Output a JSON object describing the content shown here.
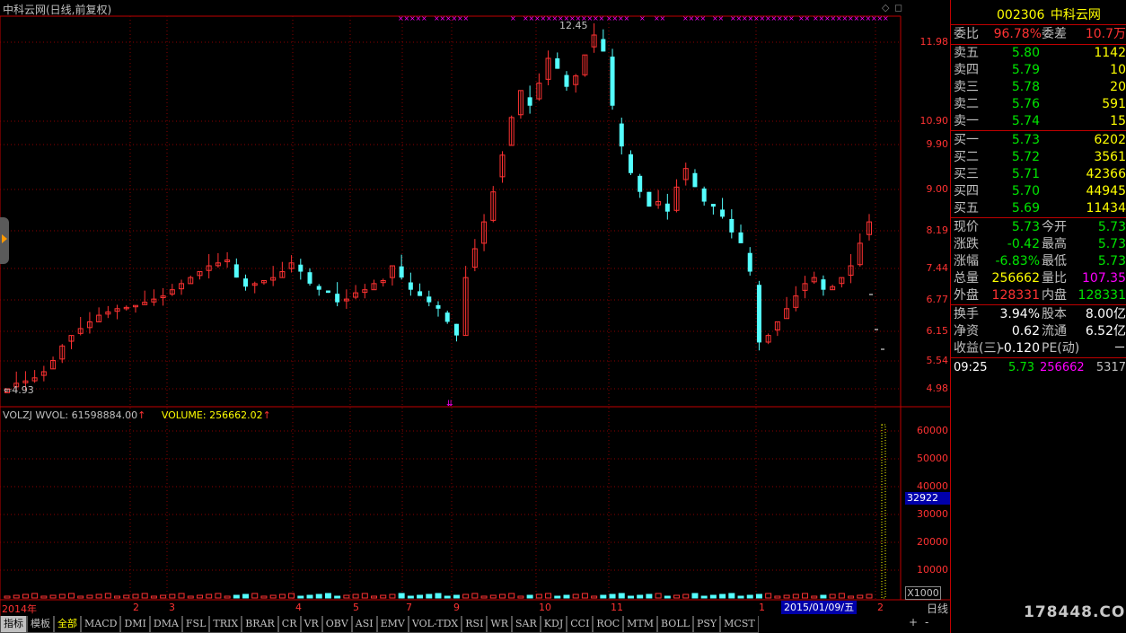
{
  "chart_header": {
    "title": "中科云网(日线,前复权)",
    "high_label": "12.45",
    "low_label": "4.93"
  },
  "price_axis": [
    "11.98",
    "10.90",
    "9.90",
    "9.00",
    "8.19",
    "7.44",
    "6.77",
    "6.15",
    "5.54",
    "4.98"
  ],
  "volume_header": {
    "volzj": "VOLZJ",
    "wvol": "WVOL: 61598884.00",
    "volume": "VOLUME: 256662.02"
  },
  "volume_axis": [
    "60000",
    "50000",
    "40000",
    "30000",
    "20000",
    "10000"
  ],
  "volume_axis_highlight": "32922",
  "volume_unit": "X1000",
  "time_axis": [
    "2014年",
    "2",
    "3",
    "4",
    "5",
    "7",
    "9",
    "10",
    "11",
    "1",
    "2"
  ],
  "cursor_date": "2015/01/09/五",
  "period_label": "日线",
  "zoom_buttons": [
    "+",
    "-"
  ],
  "indicator_tabs": [
    "指标",
    "模板",
    "全部",
    "MACD",
    "DMI",
    "DMA",
    "FSL",
    "TRIX",
    "BRAR",
    "CR",
    "VR",
    "OBV",
    "ASI",
    "EMV",
    "VOL-TDX",
    "RSI",
    "WR",
    "SAR",
    "KDJ",
    "CCI",
    "ROC",
    "MTM",
    "BOLL",
    "PSY",
    "MCST"
  ],
  "active_tab": "全部",
  "quote": {
    "code": "002306",
    "name": "中科云网",
    "weibi_label": "委比",
    "weibi": "96.78%",
    "weicha_label": "委差",
    "weicha": "10.7万",
    "sell": [
      {
        "label": "卖五",
        "price": "5.80",
        "vol": "1142"
      },
      {
        "label": "卖四",
        "price": "5.79",
        "vol": "10"
      },
      {
        "label": "卖三",
        "price": "5.78",
        "vol": "20"
      },
      {
        "label": "卖二",
        "price": "5.76",
        "vol": "591"
      },
      {
        "label": "卖一",
        "price": "5.74",
        "vol": "15"
      }
    ],
    "buy": [
      {
        "label": "买一",
        "price": "5.73",
        "vol": "6202"
      },
      {
        "label": "买二",
        "price": "5.72",
        "vol": "3561"
      },
      {
        "label": "买三",
        "price": "5.71",
        "vol": "42366"
      },
      {
        "label": "买四",
        "price": "5.70",
        "vol": "44945"
      },
      {
        "label": "买五",
        "price": "5.69",
        "vol": "11434"
      }
    ],
    "stats": [
      {
        "l1": "现价",
        "v1": "5.73",
        "l2": "今开",
        "v2": "5.73"
      },
      {
        "l1": "涨跌",
        "v1": "-0.42",
        "l2": "最高",
        "v2": "5.73"
      },
      {
        "l1": "涨幅",
        "v1": "-6.83%",
        "l2": "最低",
        "v2": "5.73"
      },
      {
        "l1": "总量",
        "v1": "256662",
        "l2": "量比",
        "v2": "107.35"
      },
      {
        "l1": "外盘",
        "v1": "128331",
        "l2": "内盘",
        "v2": "128331"
      }
    ],
    "fin": [
      {
        "l1": "换手",
        "v1": "3.94%",
        "l2": "股本",
        "v2": "8.00亿"
      },
      {
        "l1": "净资",
        "v1": "0.62",
        "l2": "流通",
        "v2": "6.52亿"
      },
      {
        "l1": "收益(三)",
        "v1": "-0.120",
        "l2": "PE(动)",
        "v2": "－"
      }
    ],
    "tick": {
      "time": "09:25",
      "price": "5.73",
      "vol": "256662",
      "extra": "5317"
    }
  },
  "watermark": "178448.COM",
  "colors": {
    "up": "#ff3232",
    "down": "#54ffff",
    "grid": "#8b0000",
    "axis": "#c00000",
    "marker": "#ff00ff"
  },
  "chart_data": {
    "type": "candlestick",
    "title": "中科云网(日线,前复权)",
    "y_axis_ticks": [
      11.98,
      10.9,
      9.9,
      9.0,
      8.19,
      7.44,
      6.77,
      6.15,
      5.54,
      4.98
    ],
    "y_scale": "log",
    "x_labels": [
      "2014年",
      "2",
      "3",
      "4",
      "5",
      "7",
      "9",
      "10",
      "11",
      "1",
      "2"
    ],
    "annotations": [
      {
        "label": "12.45",
        "type": "max"
      },
      {
        "label": "4.93",
        "type": "min"
      }
    ],
    "close_series_approx": [
      4.98,
      5.05,
      5.08,
      5.12,
      5.2,
      5.35,
      5.55,
      5.7,
      5.8,
      5.9,
      6.0,
      6.05,
      6.1,
      6.12,
      6.15,
      6.2,
      6.25,
      6.3,
      6.4,
      6.5,
      6.6,
      6.7,
      6.8,
      6.85,
      6.9,
      6.6,
      6.45,
      6.5,
      6.55,
      6.6,
      6.7,
      6.85,
      6.7,
      6.5,
      6.4,
      6.35,
      6.2,
      6.25,
      6.35,
      6.4,
      6.5,
      6.55,
      6.8,
      6.6,
      6.4,
      6.3,
      6.2,
      6.1,
      5.9,
      5.7,
      6.6,
      7.1,
      7.6,
      8.2,
      9.0,
      9.9,
      10.6,
      10.2,
      10.8,
      11.5,
      11.2,
      10.7,
      11.0,
      11.6,
      12.2,
      11.7,
      10.2,
      9.2,
      8.6,
      8.2,
      7.9,
      8.0,
      7.8,
      8.3,
      8.7,
      8.3,
      8.0,
      7.9,
      7.7,
      7.4,
      7.2,
      6.7,
      5.6,
      5.7,
      5.9,
      6.1,
      6.3,
      6.5,
      6.6,
      6.4,
      6.45,
      6.6,
      6.8,
      7.2,
      7.6
    ],
    "volume_unit": "X1000",
    "volume_axis_ticks": [
      60000,
      50000,
      40000,
      30000,
      20000,
      10000
    ],
    "last_volume": 256662.02
  }
}
